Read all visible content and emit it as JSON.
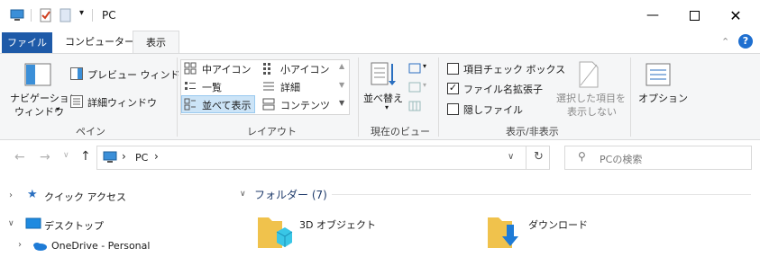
{
  "title": {
    "path": "PC"
  },
  "tabs": {
    "file": "ファイル",
    "computer": "コンピューター",
    "view": "表示"
  },
  "pane_group": {
    "nav_pane_line1": "ナビゲーション",
    "nav_pane_line2": "ウィンドウ",
    "preview_pane": "プレビュー ウィンドウ",
    "details_pane": "詳細ウィンドウ",
    "label": "ペイン"
  },
  "layout_group": {
    "items": [
      "中アイコン",
      "小アイコン",
      "一覧",
      "詳細",
      "並べて表示",
      "コンテンツ"
    ],
    "label": "レイアウト"
  },
  "current_view_group": {
    "sort_by": "並べ替え",
    "label": "現在のビュー"
  },
  "show_hide_group": {
    "item_checkboxes": "項目チェック ボックス",
    "file_extensions": "ファイル名拡張子",
    "hidden_items": "隠しファイル",
    "hide_selected_line1": "選択した項目を",
    "hide_selected_line2": "表示しない",
    "label": "表示/非表示"
  },
  "options": {
    "label": "オプション"
  },
  "address": {
    "crumb": "PC",
    "chev": "›"
  },
  "search": {
    "placeholder": "PCの検索"
  },
  "nav_pane": {
    "quick_access": "クイック アクセス",
    "desktop": "デスクトップ",
    "onedrive": "OneDrive - Personal"
  },
  "content": {
    "folders_header": "フォルダー (7)",
    "folders": [
      "3D オブジェクト",
      "ダウンロード"
    ]
  },
  "colors": {
    "accent": "#1e5aa8",
    "ribbon_bg": "#f5f6f7",
    "folder": "#f0c24c"
  }
}
